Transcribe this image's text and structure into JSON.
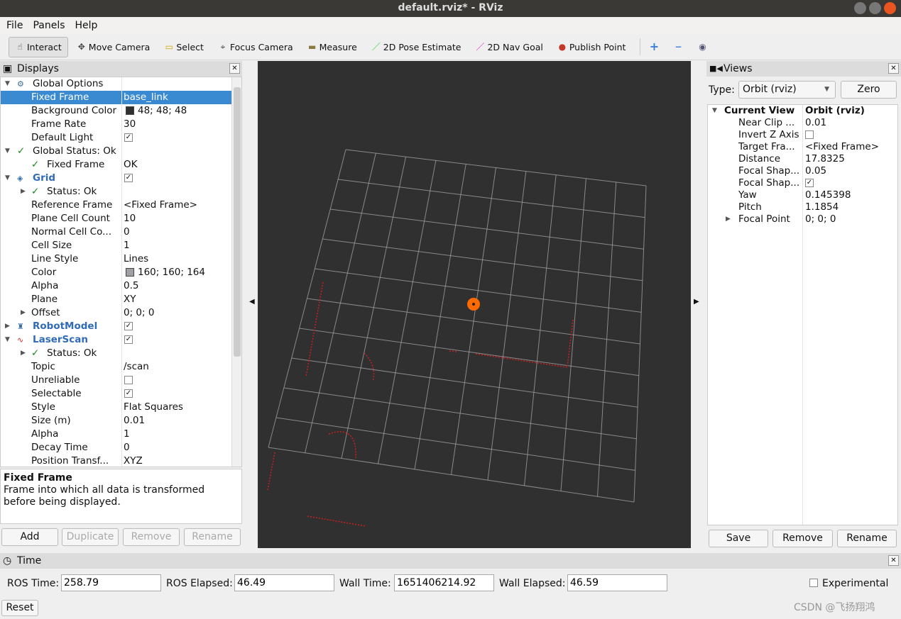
{
  "window": {
    "title": "default.rviz* - RViz"
  },
  "menu": [
    "File",
    "Panels",
    "Help"
  ],
  "toolbar": [
    {
      "label": "Interact",
      "icon": "hand-icon",
      "active": true
    },
    {
      "label": "Move Camera",
      "icon": "move-camera-icon"
    },
    {
      "label": "Select",
      "icon": "select-icon"
    },
    {
      "label": "Focus Camera",
      "icon": "focus-camera-icon"
    },
    {
      "label": "Measure",
      "icon": "ruler-icon"
    },
    {
      "label": "2D Pose Estimate",
      "icon": "green-arrow-icon"
    },
    {
      "label": "2D Nav Goal",
      "icon": "magenta-arrow-icon"
    },
    {
      "label": "Publish Point",
      "icon": "map-pin-icon"
    }
  ],
  "displays": {
    "title": "Displays",
    "rows": [
      {
        "k": "Global Options",
        "v": "",
        "indent": 0,
        "exp": "down",
        "icon": "gear-icon"
      },
      {
        "k": "Fixed Frame",
        "v": "base_link",
        "indent": 1,
        "selected": true
      },
      {
        "k": "Background Color",
        "v": "48; 48; 48",
        "indent": 1,
        "swatch": "#303030"
      },
      {
        "k": "Frame Rate",
        "v": "30",
        "indent": 1
      },
      {
        "k": "Default Light",
        "v": "",
        "indent": 1,
        "check": true
      },
      {
        "k": "Global Status: Ok",
        "v": "",
        "indent": 0,
        "exp": "down",
        "status": true
      },
      {
        "k": "Fixed Frame",
        "v": "OK",
        "indent": 1,
        "status": true
      },
      {
        "k": "Grid",
        "v": "",
        "indent": 0,
        "exp": "down",
        "blue": true,
        "check": true,
        "icon": "grid-icon"
      },
      {
        "k": "Status: Ok",
        "v": "",
        "indent": 1,
        "exp": "right",
        "status": true
      },
      {
        "k": "Reference Frame",
        "v": "<Fixed Frame>",
        "indent": 1
      },
      {
        "k": "Plane Cell Count",
        "v": "10",
        "indent": 1
      },
      {
        "k": "Normal Cell Co...",
        "v": "0",
        "indent": 1
      },
      {
        "k": "Cell Size",
        "v": "1",
        "indent": 1
      },
      {
        "k": "Line Style",
        "v": "Lines",
        "indent": 1
      },
      {
        "k": "Color",
        "v": "160; 160; 164",
        "indent": 1,
        "swatch": "#a0a0a4"
      },
      {
        "k": "Alpha",
        "v": "0.5",
        "indent": 1
      },
      {
        "k": "Plane",
        "v": "XY",
        "indent": 1
      },
      {
        "k": "Offset",
        "v": "0; 0; 0",
        "indent": 1,
        "exp": "right"
      },
      {
        "k": "RobotModel",
        "v": "",
        "indent": 0,
        "exp": "right",
        "blue": true,
        "check": true,
        "icon": "robot-icon"
      },
      {
        "k": "LaserScan",
        "v": "",
        "indent": 0,
        "exp": "down",
        "blue": true,
        "check": true,
        "icon": "laser-icon"
      },
      {
        "k": "Status: Ok",
        "v": "",
        "indent": 1,
        "exp": "right",
        "status": true
      },
      {
        "k": "Topic",
        "v": "/scan",
        "indent": 1
      },
      {
        "k": "Unreliable",
        "v": "",
        "indent": 1,
        "check": false
      },
      {
        "k": "Selectable",
        "v": "",
        "indent": 1,
        "check": true
      },
      {
        "k": "Style",
        "v": "Flat Squares",
        "indent": 1
      },
      {
        "k": "Size (m)",
        "v": "0.01",
        "indent": 1
      },
      {
        "k": "Alpha",
        "v": "1",
        "indent": 1
      },
      {
        "k": "Decay Time",
        "v": "0",
        "indent": 1
      },
      {
        "k": "Position Transf...",
        "v": "XYZ",
        "indent": 1
      }
    ],
    "help_title": "Fixed Frame",
    "help_text": "Frame into which all data is transformed before being displayed.",
    "buttons": [
      "Add",
      "Duplicate",
      "Remove",
      "Rename"
    ]
  },
  "views": {
    "title": "Views",
    "type_label": "Type:",
    "type_value": "Orbit (rviz)",
    "zero": "Zero",
    "rows": [
      {
        "k": "Current View",
        "v": "Orbit (rviz)",
        "bold": true,
        "exp": "down"
      },
      {
        "k": "Near Clip ...",
        "v": "0.01"
      },
      {
        "k": "Invert Z Axis",
        "v": "",
        "check": false
      },
      {
        "k": "Target Fra...",
        "v": "<Fixed Frame>"
      },
      {
        "k": "Distance",
        "v": "17.8325"
      },
      {
        "k": "Focal Shap...",
        "v": "0.05"
      },
      {
        "k": "Focal Shap...",
        "v": "",
        "check": true
      },
      {
        "k": "Yaw",
        "v": "0.145398"
      },
      {
        "k": "Pitch",
        "v": "1.1854"
      },
      {
        "k": "Focal Point",
        "v": "0; 0; 0",
        "exp": "right"
      }
    ],
    "buttons": [
      "Save",
      "Remove",
      "Rename"
    ]
  },
  "time": {
    "title": "Time",
    "ros_time_label": "ROS Time:",
    "ros_time": "258.79",
    "ros_elapsed_label": "ROS Elapsed:",
    "ros_elapsed": "46.49",
    "wall_time_label": "Wall Time:",
    "wall_time": "1651406214.92",
    "wall_elapsed_label": "Wall Elapsed:",
    "wall_elapsed": "46.59",
    "experimental": "Experimental",
    "reset": "Reset"
  },
  "watermark": "CSDN @飞扬翔鸿",
  "colors": {
    "background": "#303030",
    "grid": "#a0a0a4",
    "laser": "#cc1f1f",
    "focal": "#ff6a00",
    "selection": "#3a8ad2"
  }
}
